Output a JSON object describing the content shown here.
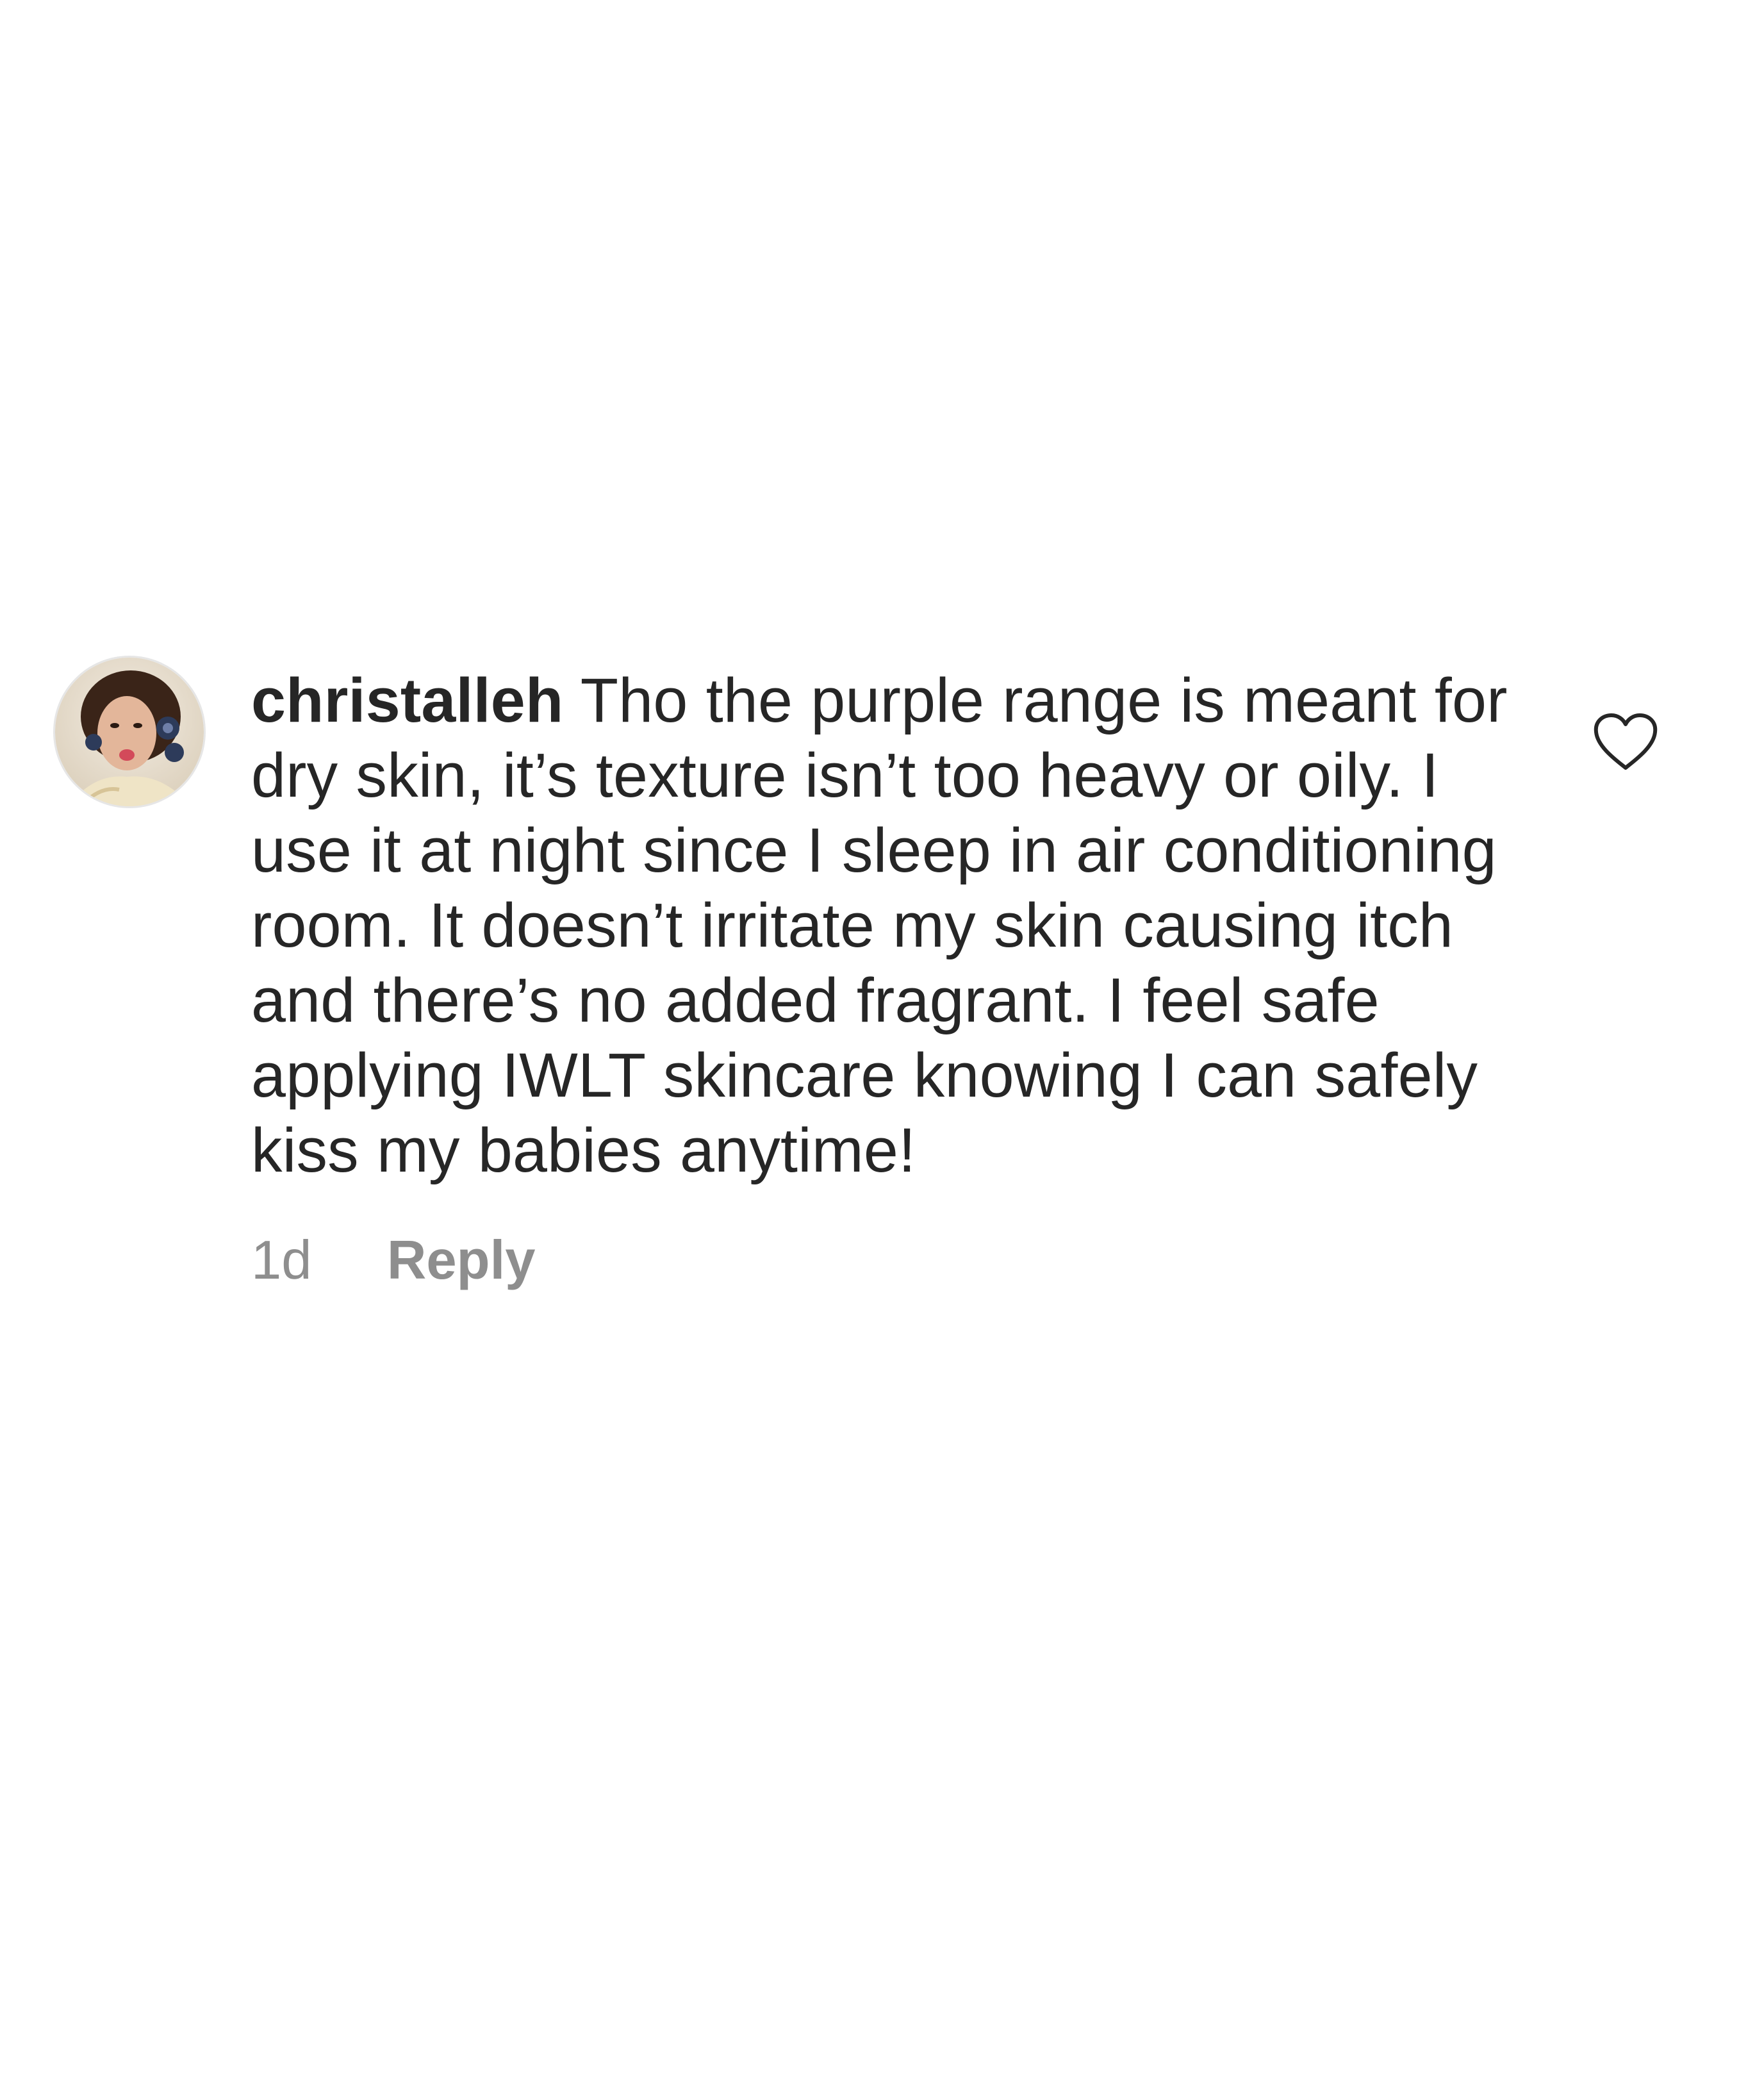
{
  "comment": {
    "username": "christalleh",
    "text": "Tho the purple range is meant for dry skin, it’s texture isn’t too heavy or oily. I use it at night since I sleep in air conditioning room. It doesn’t irritate my skin causing itch and there’s no added fragrant. I feel safe applying IWLT skincare knowing I can safely kiss my babies anytime!",
    "timestamp": "1d",
    "reply_label": "Reply"
  },
  "icons": {
    "avatar": "profile-photo",
    "like": "heart-outline-icon"
  },
  "colors": {
    "text": "#262626",
    "meta_text": "#8e8e8e",
    "background": "#ffffff"
  }
}
